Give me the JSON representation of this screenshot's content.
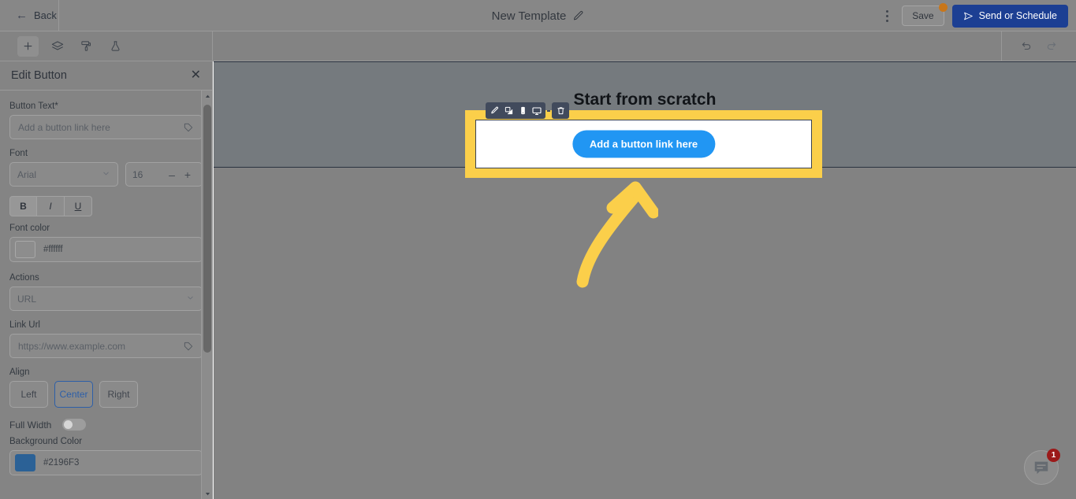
{
  "topbar": {
    "back_label": "Back",
    "back_icon": "arrow-left-icon",
    "doc_title": "New Template",
    "title_edit_icon": "pencil-icon",
    "kebab_icon": "more-vertical-icon",
    "save_label": "Save",
    "save_badge": "unsaved-dot",
    "send_label": "Send or Schedule",
    "send_icon": "paper-plane-icon"
  },
  "subtoolbar": {
    "tools": [
      {
        "icon": "plus-icon",
        "name": "add-content-tool",
        "active": true
      },
      {
        "icon": "layers-icon",
        "name": "layers-tool",
        "active": false
      },
      {
        "icon": "paint-roller-icon",
        "name": "styles-tool",
        "active": false
      },
      {
        "icon": "flask-icon",
        "name": "test-tool",
        "active": false
      }
    ],
    "undo_icon": "undo-icon",
    "redo_icon": "redo-icon"
  },
  "sidebar": {
    "title": "Edit Button",
    "close_icon": "close-icon",
    "button_text": {
      "label": "Button Text*",
      "value": "Add a button link here",
      "tag_icon": "tag-icon"
    },
    "font": {
      "label": "Font",
      "family": "Arial",
      "size": "16",
      "minus": "–",
      "plus": "+",
      "chevron_icon": "chevron-down-icon"
    },
    "text_style": {
      "bold": "B",
      "italic": "I",
      "underline": "U"
    },
    "font_color": {
      "label": "Font color",
      "value": "#ffffff",
      "swatch_hex": "#ffffff"
    },
    "actions": {
      "label": "Actions",
      "value": "URL",
      "chevron_icon": "chevron-down-icon"
    },
    "link_url": {
      "label": "Link Url",
      "value": "https://www.example.com",
      "tag_icon": "tag-icon"
    },
    "align": {
      "label": "Align",
      "options": [
        "Left",
        "Center",
        "Right"
      ],
      "selected": "Center"
    },
    "full_width": {
      "label": "Full Width",
      "enabled": false
    },
    "background_color": {
      "label": "Background Color",
      "value": "#2196F3",
      "swatch_hex": "#2196F3"
    },
    "scrollbar": {
      "up_icon": "caret-up-icon",
      "down_icon": "caret-down-icon"
    }
  },
  "canvas": {
    "heading": "Start from scratch",
    "cta_button_label": "Add a button link here",
    "block_toolbar": [
      {
        "icon": "pencil-icon",
        "name": "edit-block-button"
      },
      {
        "icon": "duplicate-icon",
        "name": "duplicate-block-button"
      },
      {
        "icon": "mobile-icon",
        "name": "mobile-visibility-button"
      },
      {
        "icon": "desktop-icon",
        "name": "desktop-visibility-button"
      },
      {
        "icon": "trash-icon",
        "name": "delete-block-button"
      }
    ],
    "annotation_arrow": "curved-up-arrow"
  },
  "chat": {
    "icon": "chat-bubble-icon",
    "badge_count": "1"
  },
  "colors": {
    "highlight": "#fbcf4a",
    "cta_blue": "#2196f3",
    "send_blue": "#1c3f93",
    "badge_red": "#9b1a1a",
    "save_dot": "#c8761a"
  }
}
